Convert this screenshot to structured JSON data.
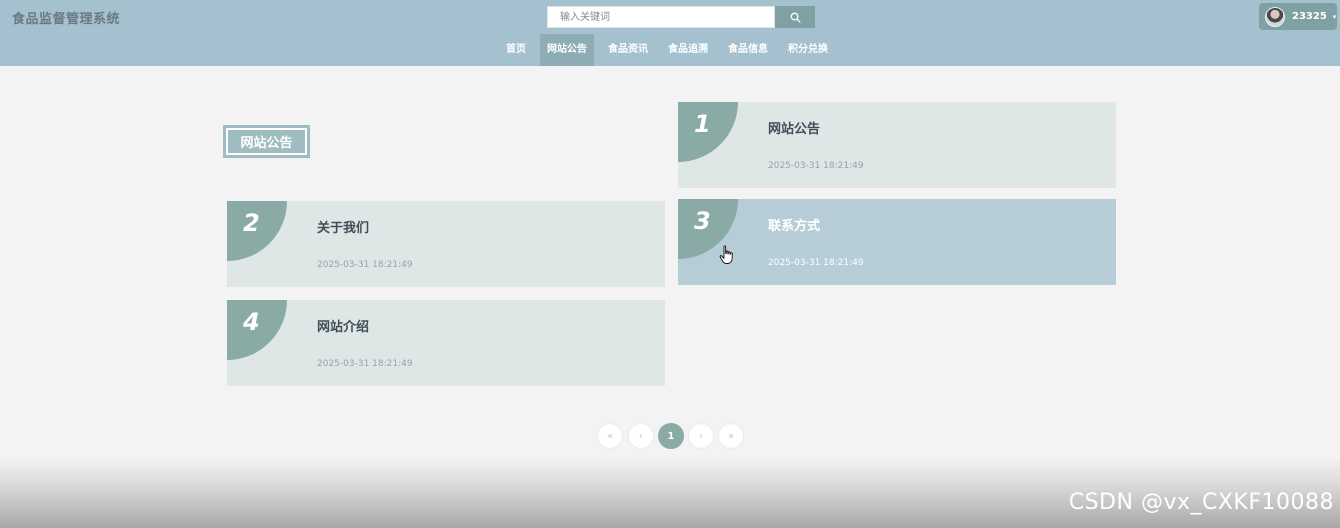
{
  "header": {
    "brand": "食品监督管理系统",
    "search": {
      "placeholder": "输入关键词",
      "value": ""
    },
    "search_icon": "search-icon",
    "user": {
      "name": "23325",
      "caret": "▾"
    }
  },
  "nav": {
    "items": [
      {
        "label": "首页"
      },
      {
        "label": "网站公告",
        "active": true
      },
      {
        "label": "食品资讯"
      },
      {
        "label": "食品追溯"
      },
      {
        "label": "食品信息"
      },
      {
        "label": "积分兑换"
      }
    ]
  },
  "section": {
    "title": "网站公告"
  },
  "cards": [
    {
      "num": "1",
      "title": "网站公告",
      "date": "2025-03-31 18:21:49"
    },
    {
      "num": "2",
      "title": "关于我们",
      "date": "2025-03-31 18:21:49"
    },
    {
      "num": "3",
      "title": "联系方式",
      "date": "2025-03-31 18:21:49"
    },
    {
      "num": "4",
      "title": "网站介绍",
      "date": "2025-03-31 18:21:49"
    }
  ],
  "pagination": {
    "first": "«",
    "prev": "‹",
    "current": "1",
    "next": "›",
    "last": "»"
  },
  "colors": {
    "header_bg": "#a5c1cf",
    "accent": "#8aaaa6",
    "card_bg": "#dfe6e6",
    "card_hover_bg": "#b6ccd6"
  },
  "watermark": "CSDN @vx_CXKF10088"
}
